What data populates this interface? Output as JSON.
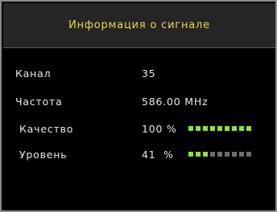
{
  "title": "Информация о сигнале",
  "rows": {
    "channel": {
      "label": "Канал",
      "value": "35"
    },
    "frequency": {
      "label": "Частота",
      "value": "586.00 MHz"
    },
    "quality": {
      "label": "Качество",
      "value": "100 %",
      "level_percent": 100,
      "segments_lit": 9,
      "segments_total": 9
    },
    "level": {
      "label": "Уровень",
      "value": "41  %",
      "level_percent": 41,
      "segments_lit": 3,
      "segments_total": 9
    }
  },
  "colors": {
    "title_text": "#f3d24a",
    "bar_on": "#8ee23b",
    "bar_off": "#6e6e6e"
  }
}
